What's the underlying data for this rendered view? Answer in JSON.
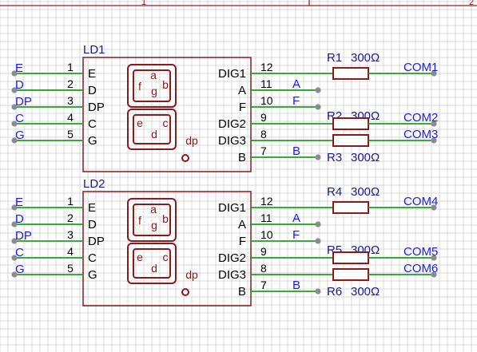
{
  "frame": {
    "ruler_marks": [
      "1",
      "2"
    ]
  },
  "colors": {
    "grid": "#d9d9d9",
    "frame": "#9b1c1c",
    "body_stroke": "#8b1a1a",
    "wire": "#1e9e1e",
    "net_label": "#1a1aff",
    "pin_text": "#000000",
    "ref_text": "#1a1a8c",
    "terminal": "#8c8c8c"
  },
  "parts": [
    {
      "ref": "LD1",
      "left_pins": [
        {
          "num": "1",
          "name": "E",
          "net": "E"
        },
        {
          "num": "2",
          "name": "D",
          "net": "D"
        },
        {
          "num": "3",
          "name": "DP",
          "net": "DP"
        },
        {
          "num": "4",
          "name": "C",
          "net": "C"
        },
        {
          "num": "5",
          "name": "G",
          "net": "G"
        }
      ],
      "right_pins": [
        {
          "num": "12",
          "name": "DIG1"
        },
        {
          "num": "11",
          "name": "A",
          "net": "A"
        },
        {
          "num": "10",
          "name": "F",
          "net": "F"
        },
        {
          "num": "9",
          "name": "DIG2"
        },
        {
          "num": "8",
          "name": "DIG3"
        },
        {
          "num": "7",
          "name": "B",
          "net": "B"
        }
      ],
      "segments": {
        "a": "a",
        "b": "b",
        "c": "c",
        "d": "d",
        "e": "e",
        "f": "f",
        "g": "g",
        "dp": "dp"
      },
      "resistors": [
        {
          "ref": "R1",
          "value": "300Ω",
          "com": "COM1"
        },
        {
          "ref": "R2",
          "value": "300Ω",
          "com": "COM2"
        },
        {
          "ref": "R3",
          "value": "300Ω",
          "com": "COM3"
        }
      ]
    },
    {
      "ref": "LD2",
      "left_pins": [
        {
          "num": "1",
          "name": "E",
          "net": "E"
        },
        {
          "num": "2",
          "name": "D",
          "net": "D"
        },
        {
          "num": "3",
          "name": "DP",
          "net": "DP"
        },
        {
          "num": "4",
          "name": "C",
          "net": "C"
        },
        {
          "num": "5",
          "name": "G",
          "net": "G"
        }
      ],
      "right_pins": [
        {
          "num": "12",
          "name": "DIG1"
        },
        {
          "num": "11",
          "name": "A",
          "net": "A"
        },
        {
          "num": "10",
          "name": "F",
          "net": "F"
        },
        {
          "num": "9",
          "name": "DIG2"
        },
        {
          "num": "8",
          "name": "DIG3"
        },
        {
          "num": "7",
          "name": "B",
          "net": "B"
        }
      ],
      "segments": {
        "a": "a",
        "b": "b",
        "c": "c",
        "d": "d",
        "e": "e",
        "f": "f",
        "g": "g",
        "dp": "dp"
      },
      "resistors": [
        {
          "ref": "R4",
          "value": "300Ω",
          "com": "COM4"
        },
        {
          "ref": "R5",
          "value": "300Ω",
          "com": "COM5"
        },
        {
          "ref": "R6",
          "value": "300Ω",
          "com": "COM6"
        }
      ]
    }
  ]
}
